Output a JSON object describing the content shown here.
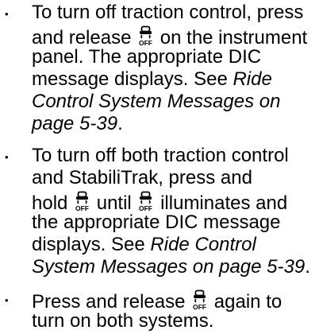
{
  "bullets": [
    {
      "text_1": "To turn off traction control, press",
      "text_2a": "and release",
      "text_2b": "on the instrument",
      "text_3": "panel. The appropriate DIC",
      "text_4a": "message displays. See",
      "ref_4": "Ride",
      "ref_5": "Control System Messages on",
      "ref_6": "page 5-39",
      "end_6": "."
    },
    {
      "text_1": "To turn off both traction control",
      "text_2": "and StabiliTrak, press and",
      "text_3a": "hold",
      "text_3b": "until",
      "text_3c": "illuminates and",
      "text_4": "the appropriate DIC message",
      "text_5a": "displays. See",
      "ref_5": "Ride Control",
      "ref_6": "System Messages on page 5-39",
      "end_6": "."
    },
    {
      "text_1a": "Press and release",
      "text_1b": "again to",
      "text_2": "turn on both systems."
    }
  ],
  "icon": {
    "name": "traction-control-off-icon",
    "label": "OFF"
  }
}
